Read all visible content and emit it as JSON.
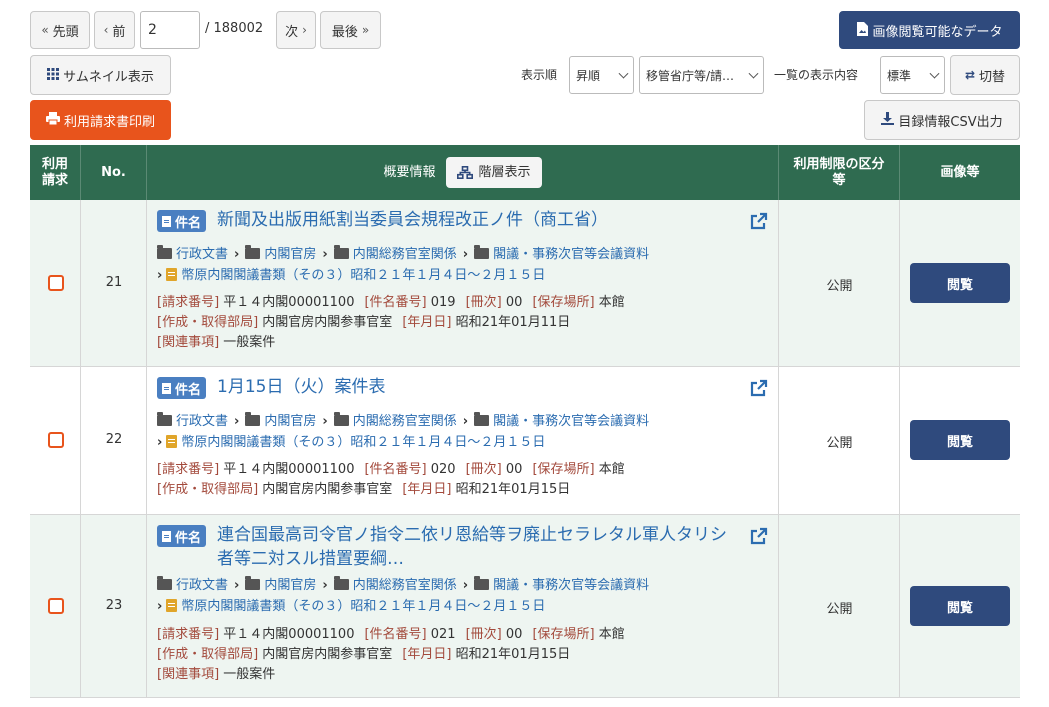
{
  "pager": {
    "first_label": "先頭",
    "prev_label": "前",
    "page_value": "2",
    "total_label": "/ 188002",
    "next_label": "次",
    "last_label": "最後"
  },
  "toolbar": {
    "image_view_label": "画像閲覧可能なデータ",
    "thumbnail_label": "サムネイル表示",
    "sort_label": "表示順",
    "sort_value": "昇順",
    "sort_field_value": "移管省庁等/請…",
    "display_content_label": "一覧の表示内容",
    "display_value": "標準",
    "switch_label": "切替",
    "print_label": "利用請求書印刷",
    "csv_label": "目録情報CSV出力"
  },
  "table": {
    "headers": {
      "request": "利用請求",
      "no": "No.",
      "summary": "概要情報",
      "hierarchy_button": "階層表示",
      "restriction": "利用制限の区分等",
      "image": "画像等"
    },
    "badge_label": "件名",
    "view_label": "閲覧",
    "rows": [
      {
        "no": "21",
        "title": "新聞及出版用紙割当委員会規程改正ノ件（商工省）",
        "crumbs": [
          "行政文書",
          "内閣官房",
          "内閣総務官室関係",
          "閣議・事務次官等会議資料"
        ],
        "series": "幣原内閣閣議書類（その３）昭和２１年１月４日～２月１５日",
        "request_no_label": "[請求番号]",
        "request_no": "平１４内閣00001100",
        "item_no_label": "[件名番号]",
        "item_no": "019",
        "volume_label": "[冊次]",
        "volume": "00",
        "location_label": "[保存場所]",
        "location": "本館",
        "dept_label": "[作成・取得部局]",
        "dept": "内閣官房内閣参事官室",
        "date_label": "[年月日]",
        "date": "昭和21年01月11日",
        "related_label": "[関連事項]",
        "related": "一般案件",
        "restriction": "公開"
      },
      {
        "no": "22",
        "title": "1月15日（火）案件表",
        "crumbs": [
          "行政文書",
          "内閣官房",
          "内閣総務官室関係",
          "閣議・事務次官等会議資料"
        ],
        "series": "幣原内閣閣議書類（その３）昭和２１年１月４日～２月１５日",
        "request_no_label": "[請求番号]",
        "request_no": "平１４内閣00001100",
        "item_no_label": "[件名番号]",
        "item_no": "020",
        "volume_label": "[冊次]",
        "volume": "00",
        "location_label": "[保存場所]",
        "location": "本館",
        "dept_label": "[作成・取得部局]",
        "dept": "内閣官房内閣参事官室",
        "date_label": "[年月日]",
        "date": "昭和21年01月15日",
        "restriction": "公開"
      },
      {
        "no": "23",
        "title": "連合国最高司令官ノ指令二依リ恩給等ヲ廃止セラレタル軍人タリシ者等二対スル措置要綱…",
        "crumbs": [
          "行政文書",
          "内閣官房",
          "内閣総務官室関係",
          "閣議・事務次官等会議資料"
        ],
        "series": "幣原内閣閣議書類（その３）昭和２１年１月４日～２月１５日",
        "request_no_label": "[請求番号]",
        "request_no": "平１４内閣00001100",
        "item_no_label": "[件名番号]",
        "item_no": "021",
        "volume_label": "[冊次]",
        "volume": "00",
        "location_label": "[保存場所]",
        "location": "本館",
        "dept_label": "[作成・取得部局]",
        "dept": "内閣官房内閣参事官室",
        "date_label": "[年月日]",
        "date": "昭和21年01月15日",
        "related_label": "[関連事項]",
        "related": "一般案件",
        "restriction": "公開"
      }
    ]
  }
}
